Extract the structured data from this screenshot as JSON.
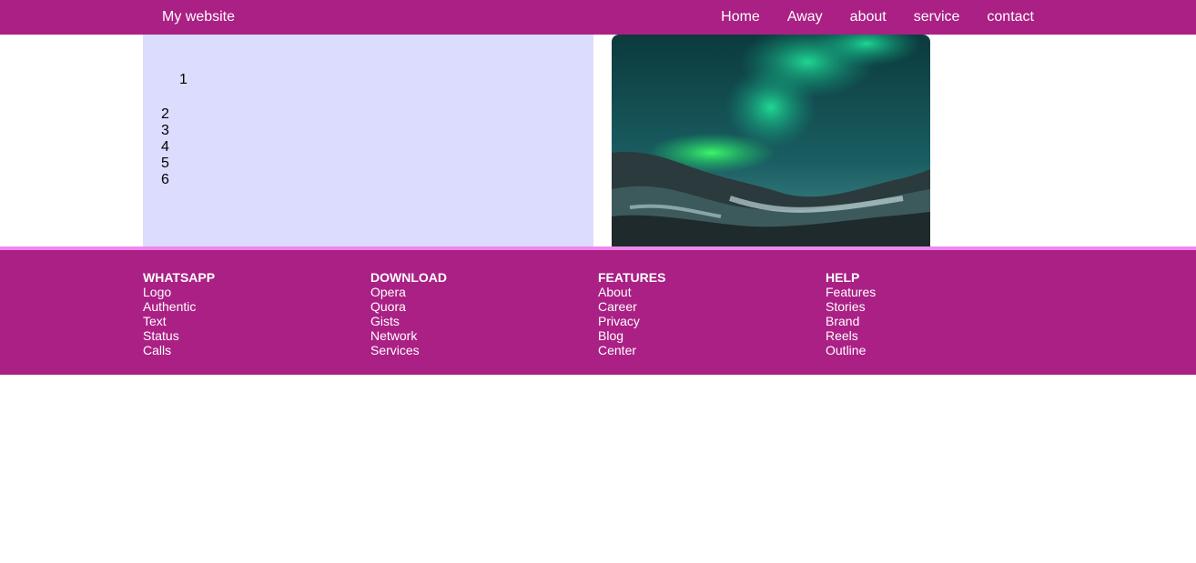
{
  "navbar": {
    "brand": "My website",
    "links": [
      "Home",
      "Away",
      "about",
      "service",
      "contact"
    ]
  },
  "content": {
    "first_item": "1",
    "items": [
      "2",
      "3",
      "4",
      "5",
      "6"
    ]
  },
  "image": {
    "alt": "Aurora borealis over snowy hills"
  },
  "footer": {
    "columns": [
      {
        "heading": "WHATSAPP",
        "links": [
          "Logo",
          "Authentic",
          "Text",
          "Status",
          "Calls"
        ]
      },
      {
        "heading": "DOWNLOAD",
        "links": [
          "Opera",
          "Quora",
          "Gists",
          "Network",
          "Services"
        ]
      },
      {
        "heading": "FEATURES",
        "links": [
          "About",
          "Career",
          "Privacy",
          "Blog",
          "Center"
        ]
      },
      {
        "heading": "HELP",
        "links": [
          "Features",
          "Stories",
          "Brand",
          "Reels",
          "Outline"
        ]
      }
    ]
  },
  "colors": {
    "primary": "#aa2085",
    "footer_border": "#ee88ee",
    "content_bg": "#dcdcff"
  }
}
